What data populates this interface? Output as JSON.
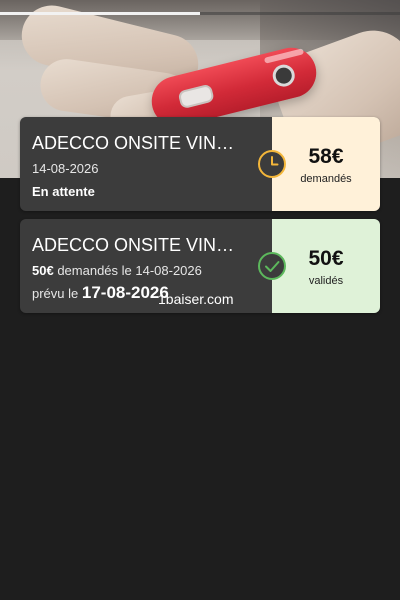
{
  "video_progress": 0.5,
  "cards": [
    {
      "title": "ADECCO ONSITE VIN…",
      "date": "14-08-2026",
      "status": "En attente",
      "amount": "58€",
      "amount_label": "demandés",
      "status_icon": "clock-icon",
      "accent_color": "#f3b63a",
      "panel_color": "#fff1d9"
    },
    {
      "title": "ADECCO ONSITE VIN…",
      "requested_amount": "50€",
      "requested_text": "demandés le 14-08-2026",
      "planned_prefix": "prévu le",
      "planned_date": "17-08-2026",
      "amount": "50€",
      "amount_label": "validés",
      "status_icon": "check-circle-icon",
      "accent_color": "#5cb85c",
      "panel_color": "#dff2d8"
    }
  ],
  "watermark": "1baiser.com"
}
